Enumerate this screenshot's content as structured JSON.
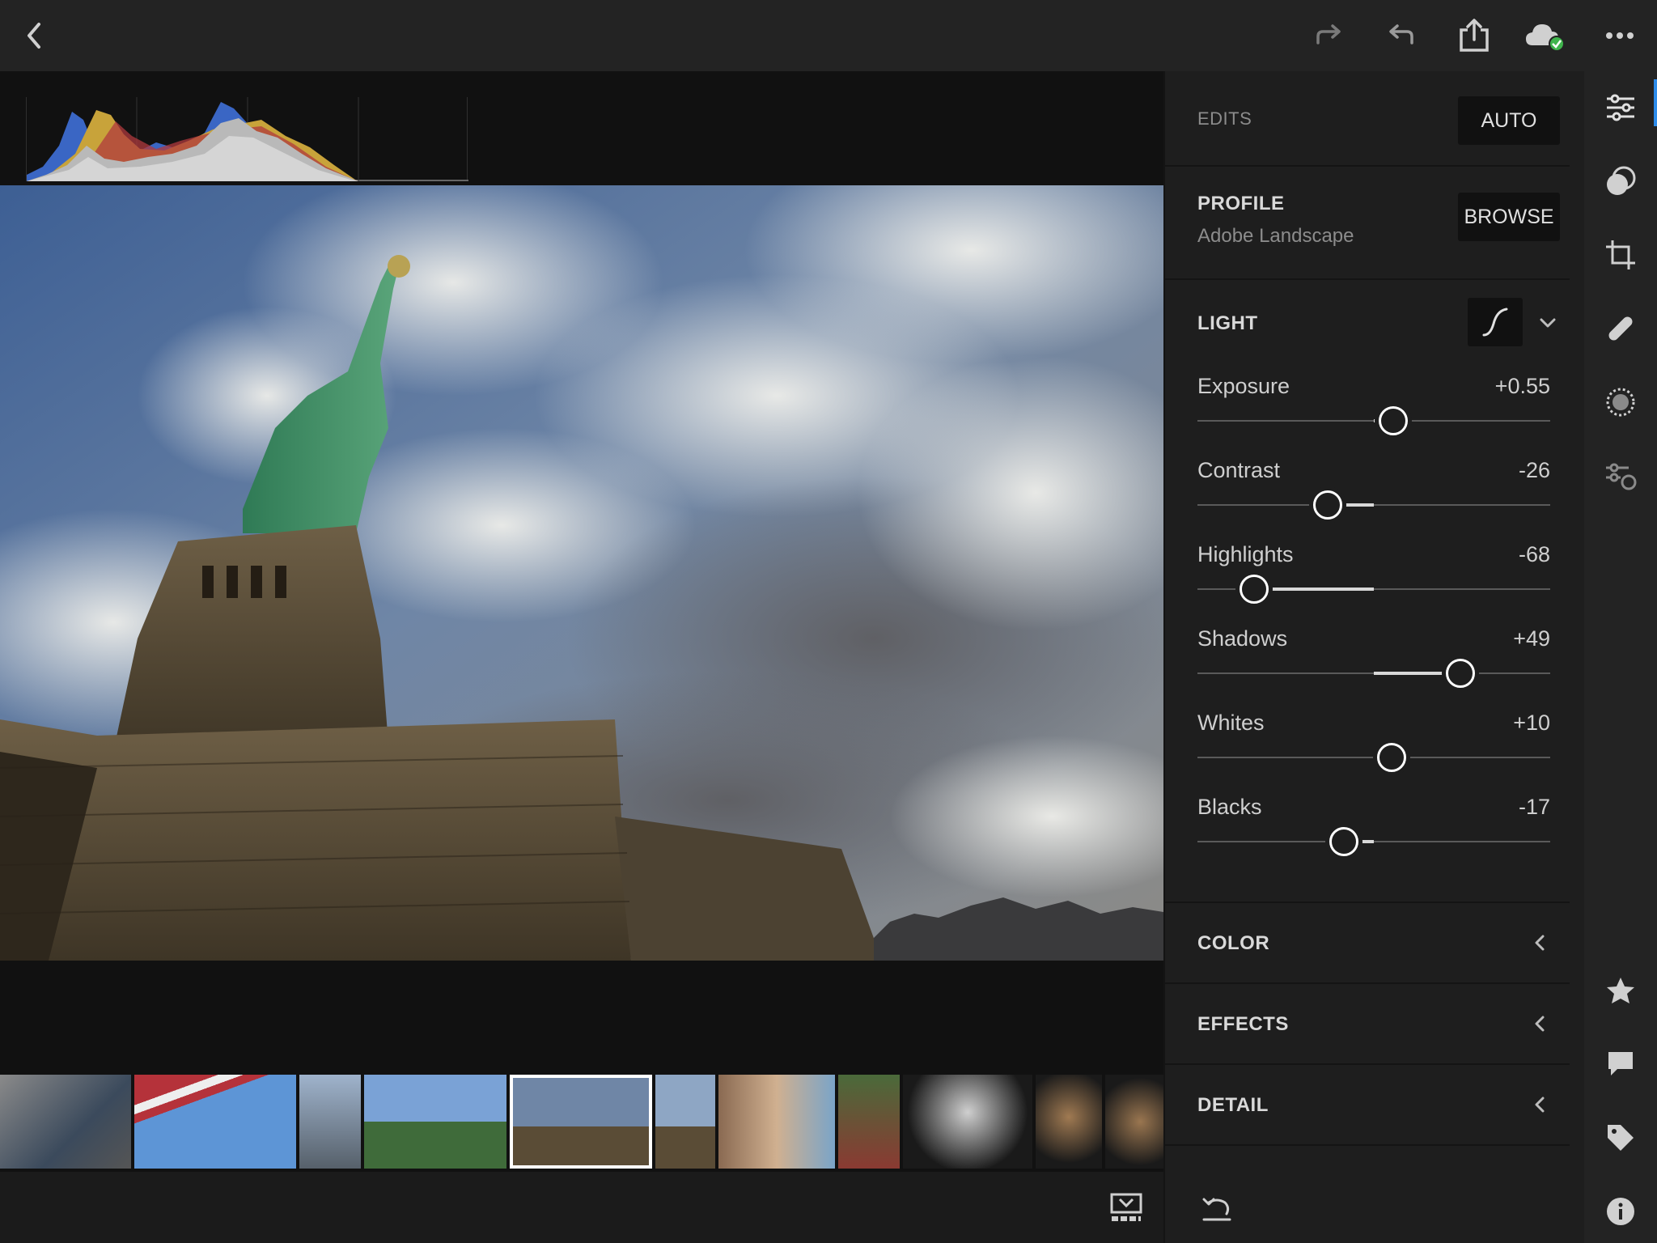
{
  "toolbar": {
    "back": "back-icon",
    "redo": "redo-icon",
    "undo": "undo-icon",
    "share": "share-icon",
    "cloud_sync": "cloud-synced-icon",
    "more": "more-icon"
  },
  "panel": {
    "edits_label": "EDITS",
    "auto_label": "AUTO",
    "profile": {
      "title": "PROFILE",
      "value": "Adobe Landscape",
      "browse_label": "BROWSE"
    },
    "light": {
      "title": "LIGHT",
      "sliders": [
        {
          "label": "Exposure",
          "value": "+0.55",
          "amount": 0.11
        },
        {
          "label": "Contrast",
          "value": "-26",
          "amount": -0.26
        },
        {
          "label": "Highlights",
          "value": "-68",
          "amount": -0.68
        },
        {
          "label": "Shadows",
          "value": "+49",
          "amount": 0.49
        },
        {
          "label": "Whites",
          "value": "+10",
          "amount": 0.1
        },
        {
          "label": "Blacks",
          "value": "-17",
          "amount": -0.17
        }
      ]
    },
    "sections": [
      {
        "title": "COLOR"
      },
      {
        "title": "EFFECTS"
      },
      {
        "title": "DETAIL"
      }
    ]
  },
  "rail": {
    "tools": [
      "edit-sliders-icon",
      "presets-icon",
      "crop-icon",
      "healing-icon",
      "selective-icon",
      "versions-icon"
    ],
    "bottom": [
      "rating-icon",
      "comment-icon",
      "keyword-icon",
      "info-icon"
    ]
  },
  "colors": {
    "accent": "#2d8ceb",
    "panel_bg": "#1e1e1e",
    "canvas_bg": "#111111"
  }
}
